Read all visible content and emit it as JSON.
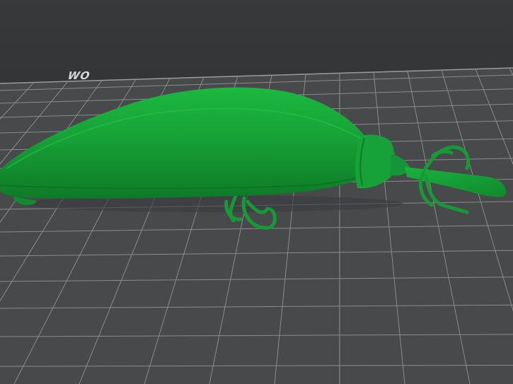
{
  "viewport": {
    "background": "#333436",
    "bed_color": "#4a4b4d",
    "grid_color": "#8a8b8d",
    "model_color": "#18a83a",
    "model_shadow": "#0f7a28"
  },
  "build_plate": {
    "logo_text": "WO",
    "logo_icon": "printer-brand-logo-icon"
  },
  "model": {
    "object_type": "fishing-lure-model",
    "icon": "fishing-lure-icon"
  }
}
